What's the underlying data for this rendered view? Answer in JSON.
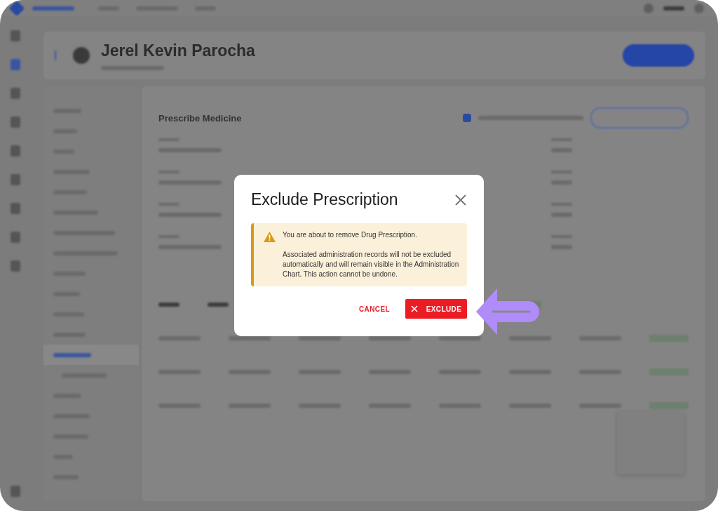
{
  "header": {
    "patient_name": "Jerel Kevin Parocha"
  },
  "content": {
    "title": "Prescribe Medicine",
    "checkbox": {
      "checked": true
    }
  },
  "dialog": {
    "title": "Exclude Prescription",
    "paragraphs": [
      "You are about to remove Drug Prescription.",
      "Associated administration records will not be excluded automatically and will remain visible in the Administration Chart. This action cannot be undone."
    ],
    "buttons": [
      {
        "kind": "text",
        "label": "CANCEL"
      },
      {
        "kind": "danger",
        "label": "EXCLUDE"
      }
    ]
  }
}
